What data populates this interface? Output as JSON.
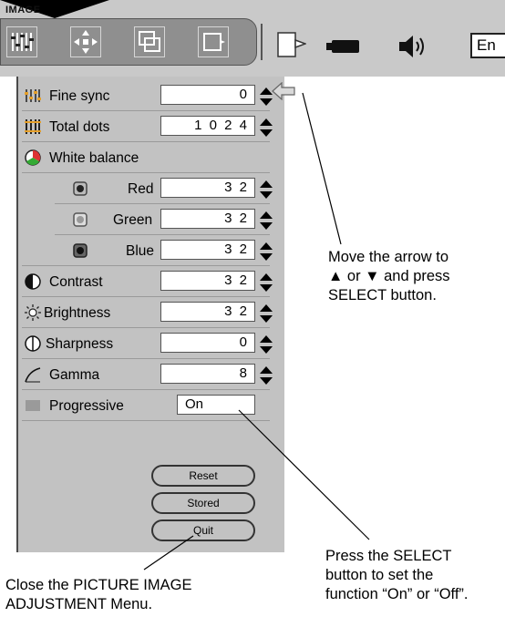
{
  "window": {
    "title": "IMAGE"
  },
  "toolbar": {
    "icons": [
      "image-adjust-icon",
      "position-icon",
      "image-select-icon",
      "screen-icon",
      "pc-system-icon",
      "camera-icon",
      "sound-icon"
    ],
    "language_label": "En"
  },
  "menu": {
    "rows": [
      {
        "label": "Fine sync",
        "value": "0",
        "icon": "fine-sync-icon"
      },
      {
        "label": "Total dots",
        "value": "1 0 2 4",
        "icon": "total-dots-icon"
      },
      {
        "label": "White balance",
        "icon": "white-balance-icon"
      },
      {
        "label": "Red",
        "value": "3 2",
        "icon": "red-icon"
      },
      {
        "label": "Green",
        "value": "3 2",
        "icon": "green-icon"
      },
      {
        "label": "Blue",
        "value": "3 2",
        "icon": "blue-icon"
      },
      {
        "label": "Contrast",
        "value": "3 2",
        "icon": "contrast-icon"
      },
      {
        "label": "Brightness",
        "value": "3 2",
        "icon": "brightness-icon"
      },
      {
        "label": "Sharpness",
        "value": "0",
        "icon": "sharpness-icon"
      },
      {
        "label": "Gamma",
        "value": "8",
        "icon": "gamma-icon"
      },
      {
        "label": "Progressive",
        "value": "On",
        "icon": "progressive-icon"
      }
    ],
    "buttons": {
      "reset": "Reset",
      "stored": "Stored",
      "quit": "Quit"
    }
  },
  "annotations": {
    "arrow_note": [
      "Move the arrow to",
      "▲ or ▼  and press",
      "SELECT button."
    ],
    "select_note": [
      "Press the SELECT",
      "button to set the",
      "function “On” or “Off”."
    ],
    "quit_note": [
      "Close the PICTURE IMAGE",
      "ADJUSTMENT Menu."
    ]
  }
}
